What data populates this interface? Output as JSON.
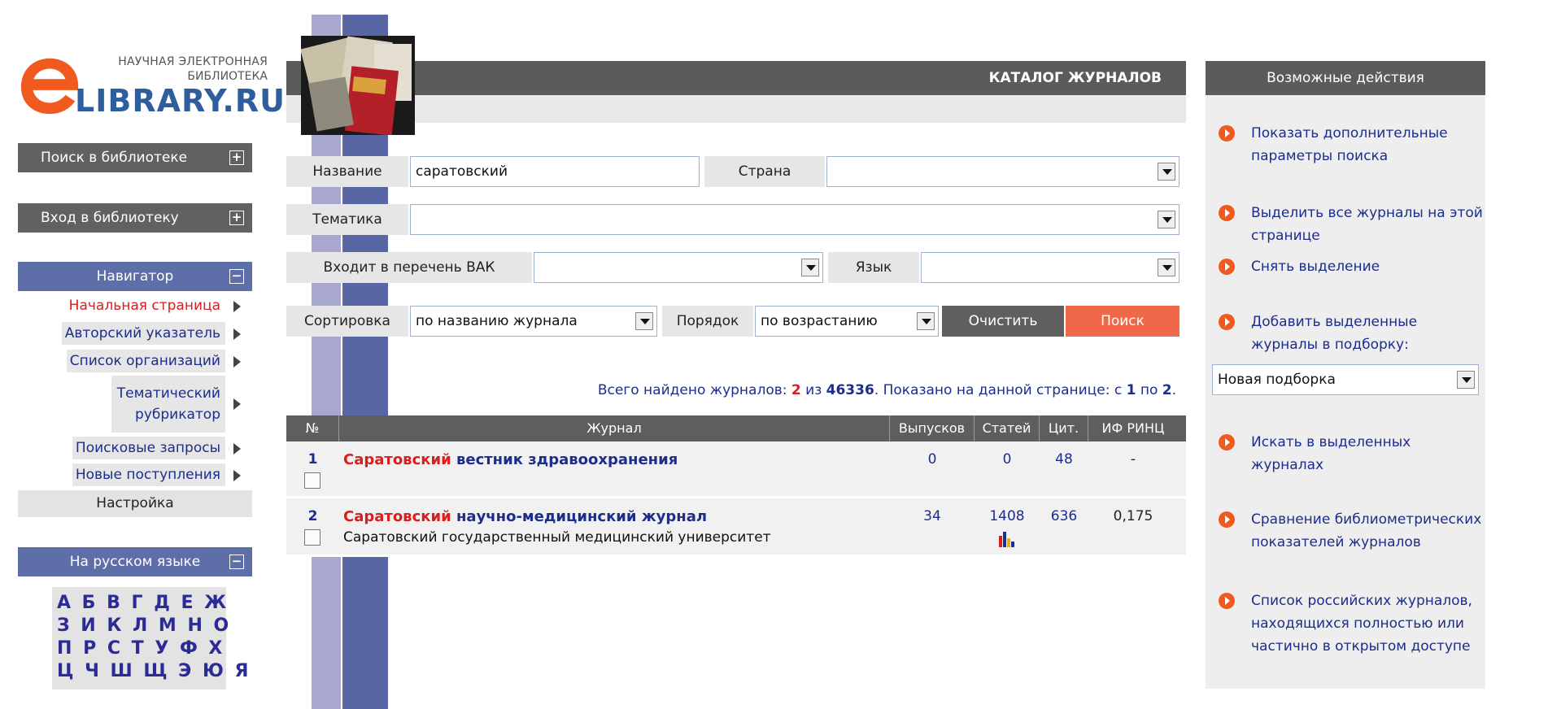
{
  "logo": {
    "line1": "НАУЧНАЯ ЭЛЕКТРОННАЯ",
    "line2": "БИБЛИОТЕКА",
    "brand": "LIBRARY.RU"
  },
  "left": {
    "search_label": "Поиск в библиотеке",
    "login_label": "Вход в библиотеку",
    "navigator_label": "Навигатор",
    "nav_items": [
      {
        "label": "Начальная страница"
      },
      {
        "label": "Авторский указатель"
      },
      {
        "label": "Список организаций"
      },
      {
        "label": "Тематический рубрикатор",
        "line1": "Тематический",
        "line2": "рубрикатор"
      },
      {
        "label": "Поисковые запросы"
      },
      {
        "label": "Новые поступления"
      }
    ],
    "settings_label": "Настройка",
    "language_label": "На русском языке",
    "alphabet_rows": [
      "А Б В Г Д Е Ж",
      "З И К Л М Н О",
      "П Р С Т У Ф Х",
      "Ц Ч Ш Щ Э Ю Я"
    ],
    "plus": "+",
    "minus": "−"
  },
  "header": {
    "title": "КАТАЛОГ ЖУРНАЛОВ"
  },
  "form": {
    "name_label": "Название",
    "name_value": "саратовский",
    "country_label": "Страна",
    "country_value": "",
    "topic_label": "Тематика",
    "topic_value": "",
    "vak_label": "Входит в перечень ВАК",
    "vak_value": "",
    "lang_label": "Язык",
    "lang_value": "",
    "sort_label": "Сортировка",
    "sort_value": "по названию журнала",
    "order_label": "Порядок",
    "order_value": "по возрастанию",
    "clear_label": "Очистить",
    "search_label": "Поиск"
  },
  "summary": {
    "prefix": "Всего найдено журналов:",
    "found": "2",
    "of_word": "из",
    "total": "46336",
    "shown_prefix": ". Показано на данной странице: с",
    "from": "1",
    "to_word": "по",
    "to": "2",
    "end": "."
  },
  "table": {
    "columns": [
      "№",
      "Журнал",
      "Выпусков",
      "Статей",
      "Цит.",
      "ИФ РИНЦ"
    ],
    "rows": [
      {
        "num": "1",
        "title_red": "Саратовский",
        "title_rest": "вестник здравоохранения",
        "subtitle": "",
        "issues": "0",
        "articles": "0",
        "citations": "48",
        "impact": "-"
      },
      {
        "num": "2",
        "title_red": "Саратовский",
        "title_rest": "научно-медицинский журнал",
        "subtitle": "Саратовский государственный медицинский университет",
        "issues": "34",
        "articles": "1408",
        "citations": "636",
        "impact": "0,175"
      }
    ]
  },
  "right": {
    "title": "Возможные действия",
    "actions": [
      {
        "text": "Показать дополнительные параметры поиска"
      },
      {
        "text": "Выделить все журналы на этой странице"
      },
      {
        "text": "Снять выделение"
      },
      {
        "text": "Добавить выделенные журналы в подборку:"
      },
      {
        "text": "Искать в выделенных журналах"
      },
      {
        "text": "Сравнение библиометрических показателей журналов"
      },
      {
        "text": "Список российских журналов, находящихся полностью или частично в открытом доступе"
      }
    ],
    "collection_select": "Новая подборка"
  },
  "colors": {
    "accent_red": "#d81e1e",
    "link_blue": "#1c2d8c",
    "orange_button": "#f05a1e",
    "dark_header": "#5b5b5b",
    "nav_blue": "#5e6ea8"
  }
}
